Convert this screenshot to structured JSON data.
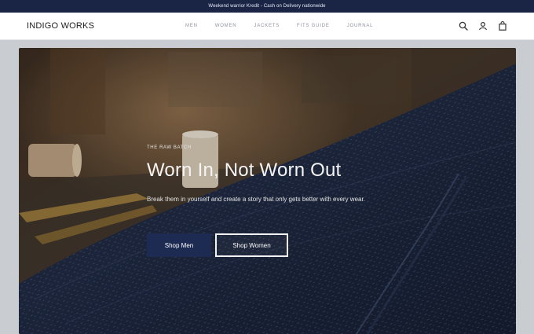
{
  "announcement": {
    "text": "Weekend warrior Kredit - Cash on Delivery nationwide"
  },
  "header": {
    "logo": "INDIGO WORKS",
    "nav": [
      "MEN",
      "WOMEN",
      "JACKETS",
      "FITS GUIDE",
      "JOURNAL"
    ],
    "icons": [
      "search-icon",
      "account-icon",
      "cart-icon"
    ]
  },
  "hero": {
    "eyebrow": "THE RAW BATCH",
    "headline": "Worn In, Not Worn Out",
    "subtext": "Break them in yourself and create a story that only gets better with every wear.",
    "primary_button": "Shop Men",
    "secondary_button": "Shop Women"
  },
  "colors": {
    "announcement_bg": "#1a2546",
    "primary_button": "#1d2a52",
    "denim": "#1f2a44"
  }
}
